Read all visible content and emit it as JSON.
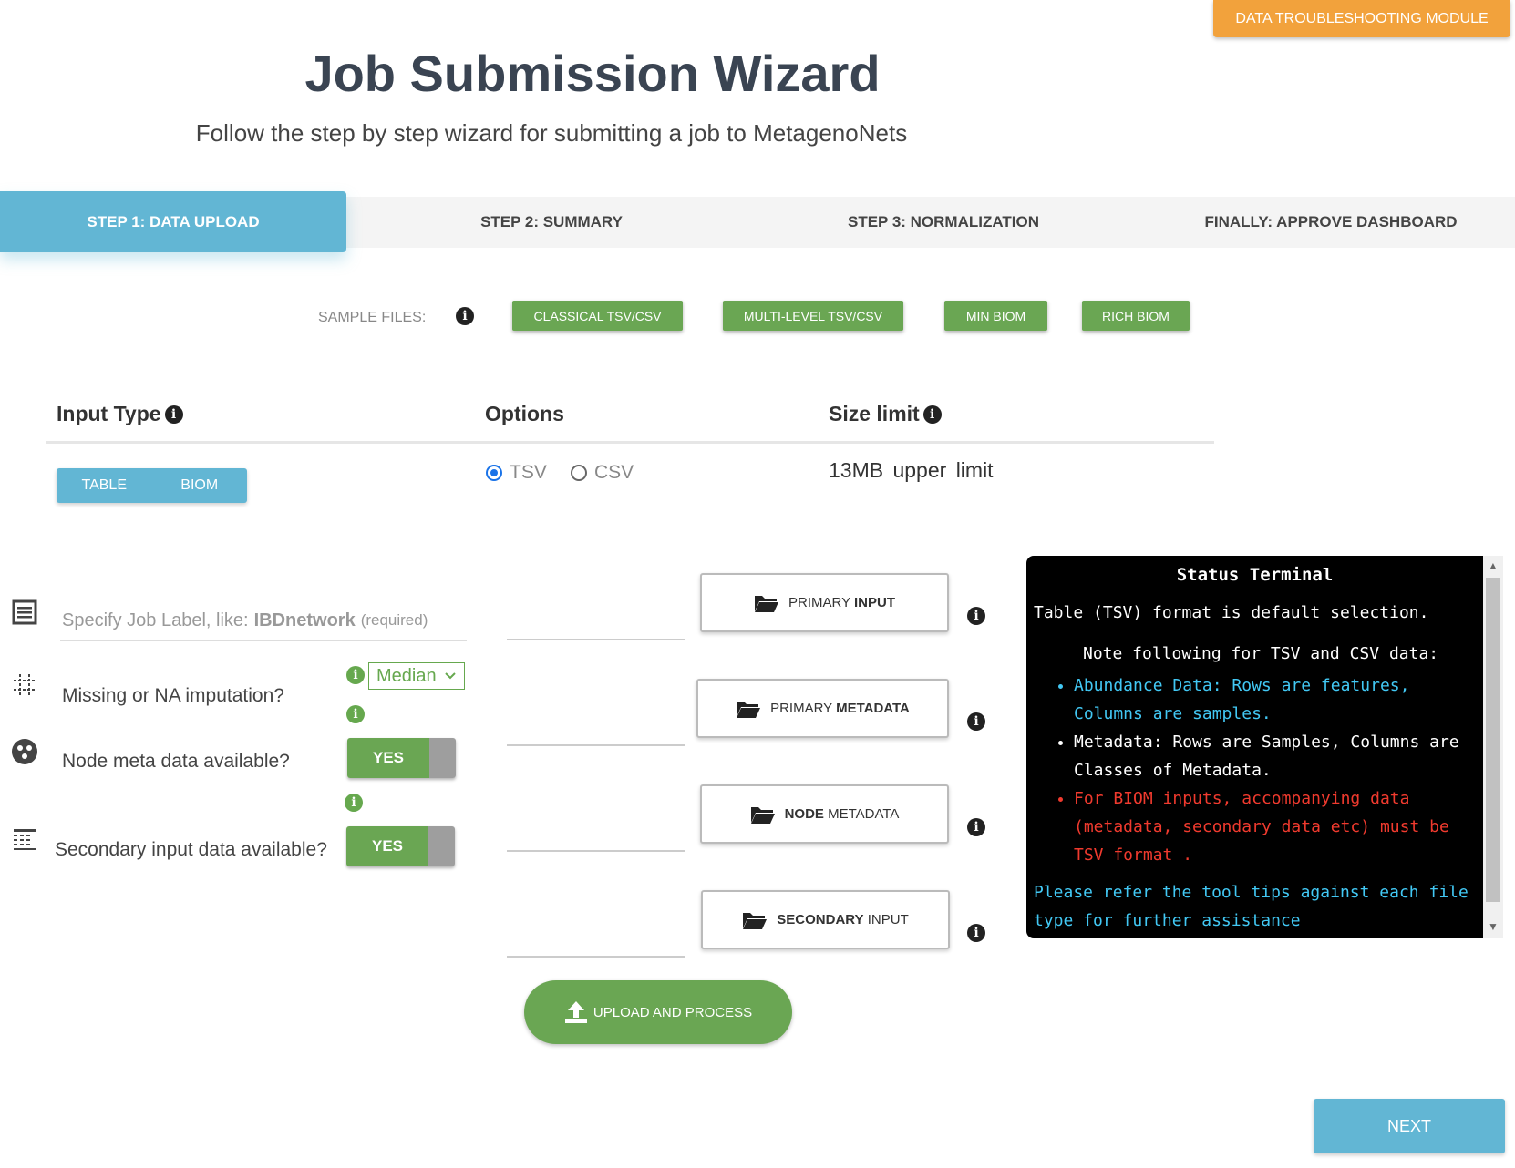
{
  "header": {
    "troubleshoot_label": "DATA TROUBLESHOOTING MODULE",
    "title": "Job Submission Wizard",
    "subtitle": "Follow the step by step wizard for submitting a job to MetagenoNets"
  },
  "steps": [
    {
      "label": "STEP 1: DATA UPLOAD",
      "active": true
    },
    {
      "label": "STEP 2: SUMMARY",
      "active": false
    },
    {
      "label": "STEP 3: NORMALIZATION",
      "active": false
    },
    {
      "label": "FINALLY: APPROVE DASHBOARD",
      "active": false
    }
  ],
  "sample_files": {
    "label": "SAMPLE FILES:",
    "info": "i",
    "buttons": [
      "CLASSICAL TSV/CSV",
      "MULTI-LEVEL TSV/CSV",
      "MIN BIOM",
      "RICH BIOM"
    ]
  },
  "columns": {
    "input_type": "Input Type",
    "options": "Options",
    "size_limit": "Size limit"
  },
  "input_type": {
    "table": "TABLE",
    "biom": "BIOM"
  },
  "options": {
    "tsv": "TSV",
    "csv": "CSV",
    "selected": "TSV"
  },
  "size_limit_text": "13MB upper limit",
  "form": {
    "job_label_placeholder": "Specify Job Label, like:",
    "job_label_example": "IBDnetwork",
    "job_label_required": "(required)",
    "missing_label": "Missing or NA imputation?",
    "missing_value": "Median",
    "node_meta_label": "Node meta data available?",
    "node_meta_value": "YES",
    "secondary_label": "Secondary input data available?",
    "secondary_value": "YES"
  },
  "files": {
    "primary_input": {
      "pre": "PRIMARY",
      "bold": "INPUT"
    },
    "primary_metadata": {
      "pre": "PRIMARY",
      "bold": "METADATA"
    },
    "node_metadata": {
      "bold": "NODE",
      "post": "METADATA"
    },
    "secondary_input": {
      "bold": "SECONDARY",
      "post": "INPUT"
    }
  },
  "upload_label": "UPLOAD AND PROCESS",
  "terminal": {
    "title": "Status Terminal",
    "line1": "Table (TSV) format is default selection.",
    "note": "Note following for TSV and CSV data:",
    "bullet1": "Abundance Data: Rows are features, Columns are samples.",
    "bullet2": "Metadata: Rows are Samples, Columns are Classes of Metadata.",
    "bullet3": "For BIOM inputs, accompanying data (metadata, secondary data etc) must be TSV format .",
    "footer": "Please refer the tool tips against each file type for further assistance"
  },
  "next_label": "NEXT",
  "colors": {
    "accent_blue": "#62b6d4",
    "green": "#6aa653",
    "orange": "#f2a23c"
  }
}
